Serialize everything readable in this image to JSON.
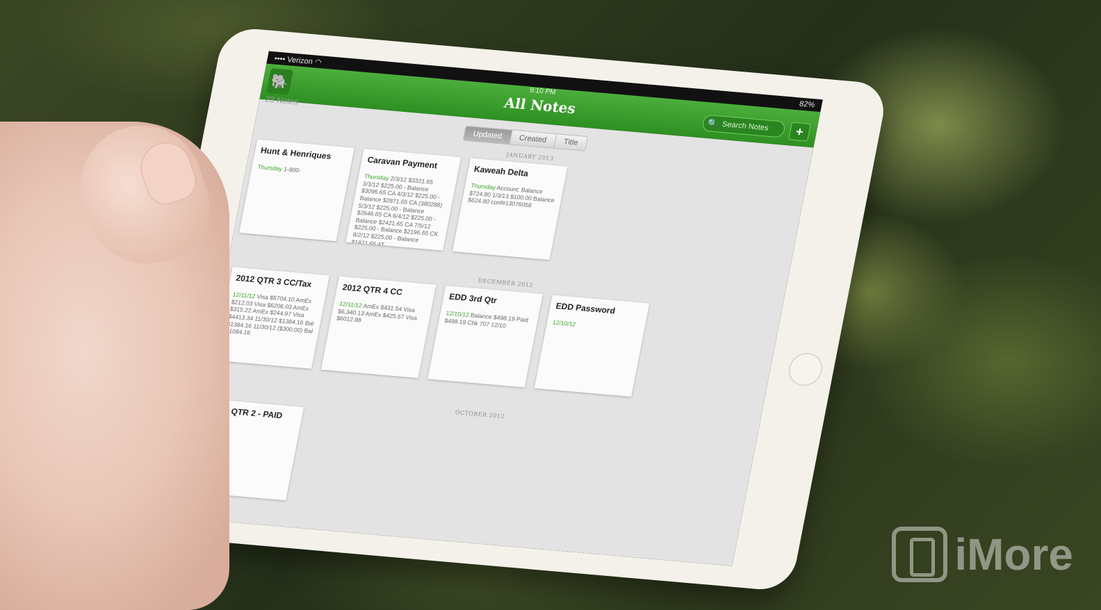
{
  "status": {
    "carrier": "Verizon",
    "time": "9:10 PM",
    "battery": "82%"
  },
  "header": {
    "title": "All Notes",
    "search_placeholder": "Search Notes",
    "add_label": "+",
    "notes_count": "23 Notes"
  },
  "sort_tabs": [
    {
      "label": "Updated",
      "active": true
    },
    {
      "label": "Created",
      "active": false
    },
    {
      "label": "Title",
      "active": false
    }
  ],
  "sections": [
    {
      "label": "JANUARY 2013",
      "notes": [
        {
          "title": "Hunt & Henriques",
          "date": "Thursday",
          "body": "1-800-"
        },
        {
          "title": "Caravan Payment",
          "date": "Thursday",
          "body": "2/3/12 $3321.65 3/3/12 $225.00 - Balance $3096.65 CA 4/3/12 $225.00 - Balance $2871.65 CA (380288) 5/3/12 $225.00 - Balance $2646.65 CA 6/4/12 $225.00 - Balance $2421.65 CA 7/5/12 $225.00 - Balance $2196.65 CK 8/2/12 $225.00 - Balance $1971.65 AT..."
        },
        {
          "title": "Kaweah Delta",
          "date": "Thursday",
          "body": "Account: Balance $724.80 1/3/13 $100.00 Balance $624.80 conf#13076058"
        }
      ]
    },
    {
      "label": "DECEMBER 2012",
      "notes": [
        {
          "title": "2012 QTR 3 CC/Tax",
          "date": "12/11/12",
          "body": "Visa $5704.10 AmEx $212.03 Visa $6206.03 AmEx $315.22 AmEx $244.97 Visa $4413.34 11/30/12 $1384.16 Bal $1384.16 11/30/12 ($300.00) Bal $1084.16"
        },
        {
          "title": "2012 QTR 4 CC",
          "date": "12/11/12",
          "body": "AmEx $431.54 Visa $6,340.13 AmEx $425.57 Visa $6012.88"
        },
        {
          "title": "EDD 3rd Qtr",
          "date": "12/10/12",
          "body": "Balance $498.19 Paid $498.19 Chk 707 12/10"
        },
        {
          "title": "EDD Password",
          "date": "12/10/12",
          "body": ""
        }
      ]
    },
    {
      "label": "OCTOBER 2012",
      "notes": [
        {
          "title": "2012 QTR 2 - PAID",
          "date": "",
          "body": ""
        }
      ]
    }
  ],
  "watermark": {
    "text": "iMore"
  },
  "icons": {
    "app": "evernote-elephant-icon",
    "search": "search-icon",
    "wifi": "wifi-icon"
  }
}
